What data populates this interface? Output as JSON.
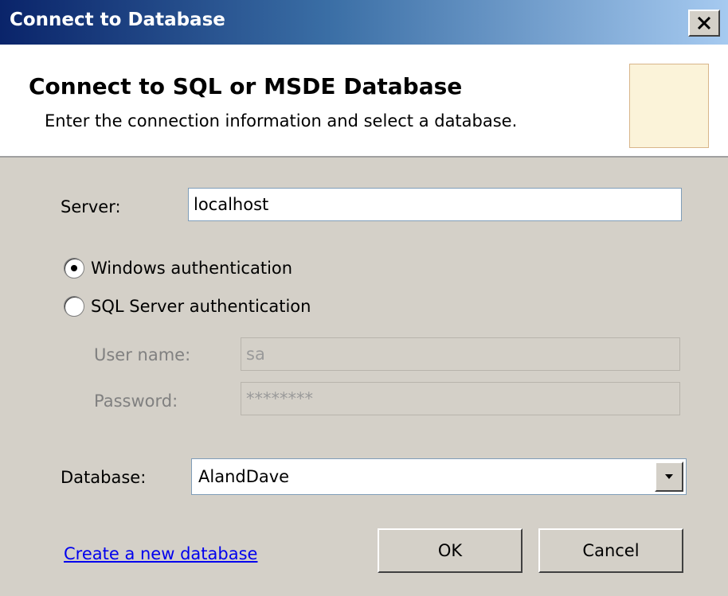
{
  "window": {
    "title": "Connect to Database",
    "close_glyph": "✕",
    "title_gradient": [
      "#0a246a",
      "#a6caf0"
    ]
  },
  "header": {
    "title": "Connect to SQL or MSDE Database",
    "subtitle": "Enter the connection information and select a database."
  },
  "server": {
    "label": "Server:",
    "value": "localhost"
  },
  "auth": {
    "options": [
      {
        "label": "Windows authentication",
        "checked": true
      },
      {
        "label": "SQL Server authentication",
        "checked": false
      }
    ],
    "username_label": "User name:",
    "username_value": "sa",
    "password_label": "Password:",
    "password_value": "********"
  },
  "database": {
    "label": "Database:",
    "selected": "AlandDave",
    "arrow_icon": "chevron-down-icon"
  },
  "footer": {
    "create_link": "Create a new database",
    "ok_label": "OK",
    "cancel_label": "Cancel",
    "link_color": "#0000ee"
  }
}
